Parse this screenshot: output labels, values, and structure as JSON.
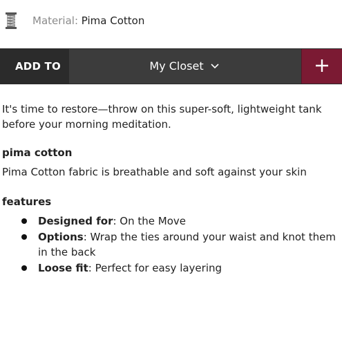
{
  "material": {
    "icon": "thread-spool-icon",
    "label": "Material:",
    "value": "Pima Cotton"
  },
  "add_bar": {
    "add_to_label": "ADD TO",
    "closet_value": "My Closet",
    "plus_label": "+"
  },
  "description": "It's time to restore—throw on this super-soft, lightweight tank before your morning meditation.",
  "pima_section": {
    "title": "pima cotton",
    "text": "Pima Cotton fabric is breathable and soft against your skin"
  },
  "features_section": {
    "title": "features",
    "items": [
      {
        "label": "Designed for",
        "text": ": On the Move"
      },
      {
        "label": "Options",
        "text": ": Wrap the ties around your waist and knot them in the back"
      },
      {
        "label": "Loose fit",
        "text": ": Perfect for easy layering"
      }
    ]
  },
  "colors": {
    "bar_background": "#3c3c3c",
    "add_to_background": "#2b2b2b",
    "plus_background": "#7b1a33"
  }
}
